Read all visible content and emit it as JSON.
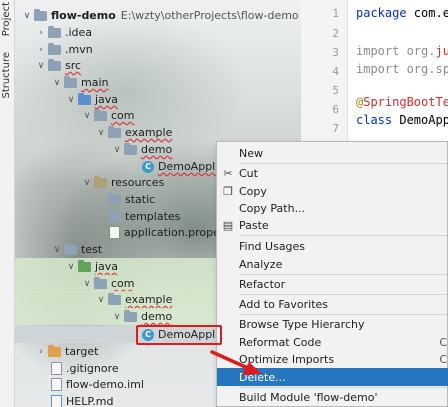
{
  "side_tabs": [
    "Project",
    "Structure"
  ],
  "tree": {
    "root_name": "flow-demo",
    "root_path": "E:\\wzty\\otherProjects\\flow-demo",
    "items": [
      {
        "label": "flow-demo"
      },
      {
        "label": ".idea"
      },
      {
        "label": ".mvn"
      },
      {
        "label": "src"
      },
      {
        "label": "main"
      },
      {
        "label": "java"
      },
      {
        "label": "com"
      },
      {
        "label": "example"
      },
      {
        "label": "demo"
      },
      {
        "label": "DemoApplic"
      },
      {
        "label": "resources"
      },
      {
        "label": "static"
      },
      {
        "label": "templates"
      },
      {
        "label": "application.properties"
      },
      {
        "label": "test"
      },
      {
        "label": "java"
      },
      {
        "label": "com"
      },
      {
        "label": "example"
      },
      {
        "label": "demo"
      },
      {
        "label": "DemoApplic"
      },
      {
        "label": "target"
      },
      {
        "label": ".gitignore"
      },
      {
        "label": "flow-demo.iml"
      },
      {
        "label": "HELP.md"
      }
    ]
  },
  "editor": {
    "line_numbers": [
      "1",
      "2",
      "3",
      "4",
      "5",
      "6",
      "7"
    ],
    "lines": {
      "l1_kw": "package",
      "l1_rest": " com.e",
      "l3_kw": "import",
      "l3_rest": " org.",
      "l3_err": "ju",
      "l4_kw": "import",
      "l4_rest": " org.spr",
      "l6_at": "@",
      "l6_ann": "SpringBootTes",
      "l7_kw": "class",
      "l7_rest": " DemoAppl"
    }
  },
  "context_menu": {
    "items": {
      "new": "New",
      "cut": "Cut",
      "copy": "Copy",
      "copy_path": "Copy Path...",
      "paste": "Paste",
      "find_usages": "Find Usages",
      "analyze": "Analyze",
      "refactor": "Refactor",
      "add_favorites": "Add to Favorites",
      "browse_hierarchy": "Browse Type Hierarchy",
      "reformat": "Reformat Code",
      "reformat_sc": "C",
      "optimize": "Optimize Imports",
      "optimize_sc": "C",
      "delete": "Delete...",
      "build_module": "Build Module 'flow-demo'"
    },
    "selected": "delete"
  },
  "colors": {
    "selection": "#2675bf",
    "annotation_red": "#e01b1b"
  }
}
